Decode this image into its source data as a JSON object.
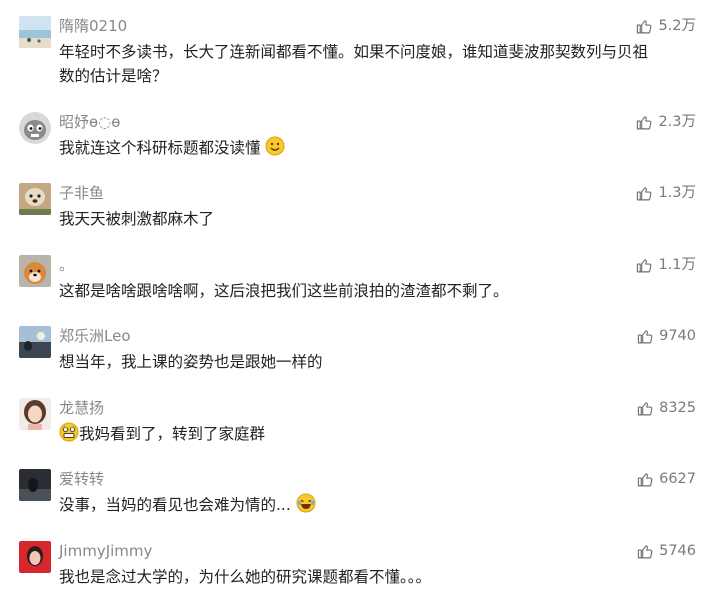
{
  "comments": [
    {
      "name": "隋隋0210",
      "text": "年轻时不多读书，长大了连新闻都看不懂。如果不问度娘，谁知道斐波那契数列与贝祖数的估计是啥？",
      "likes": "5.2万",
      "avatar": "beach"
    },
    {
      "name": "昭妤ɵ◌ɵ",
      "text": "我就连这个科研标题都没读懂",
      "likes": "2.3万",
      "avatar": "cartoon-face",
      "emoji": "smile-emoji"
    },
    {
      "name": "子非鱼",
      "text": "我天天被刺激都麻木了",
      "likes": "1.3万",
      "avatar": "dog-photo"
    },
    {
      "name": "。",
      "text": "这都是啥啥跟啥啥啊，这后浪把我们这些前浪拍的渣渣都不剩了。",
      "likes": "1.1万",
      "avatar": "shiba"
    },
    {
      "name": "郑乐洲Leo",
      "text": "想当年，我上课的姿势也是跟她一样的",
      "likes": "9740",
      "avatar": "landscape"
    },
    {
      "name": "龙慧扬",
      "text": "我妈看到了，转到了家庭群",
      "likes": "8325",
      "avatar": "girl-portrait",
      "emoji_lead": "grimace-emoji"
    },
    {
      "name": "爱转转",
      "text": "没事，当妈的看见也会难为情的...",
      "likes": "6627",
      "avatar": "dark-photo",
      "emoji": "laugh-emoji"
    },
    {
      "name": "JimmyJimmy",
      "text": "我也是念过大学的，为什么她的研究课题都看不懂。。。",
      "likes": "5746",
      "avatar": "red-photo"
    }
  ],
  "colors": {
    "name": "#888888",
    "text": "#222222",
    "likes": "#7a7a7a",
    "background": "#ffffff"
  },
  "icons": {
    "like": "thumbs-up-icon"
  }
}
